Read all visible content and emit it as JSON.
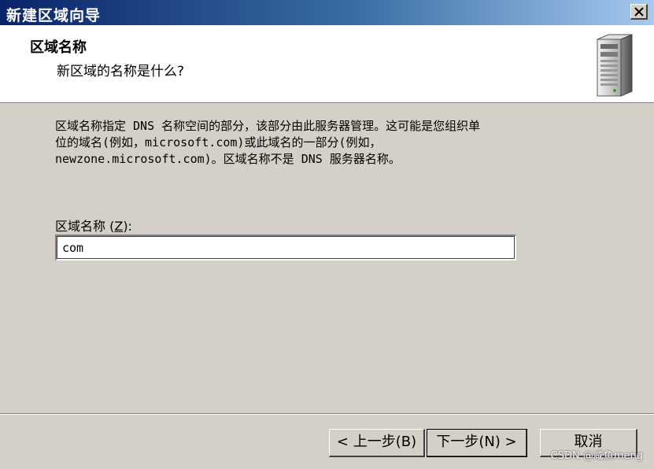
{
  "window": {
    "title": "新建区域向导",
    "close_glyph": "✕"
  },
  "header": {
    "title": "区域名称",
    "subtitle": "新区域的名称是什么?",
    "icon": "server-tower-icon"
  },
  "body": {
    "description_lines": [
      "区域名称指定 DNS 名称空间的部分，该部分由此服务器管理。这可能是您组织单",
      "位的域名(例如，microsoft.com)或此域名的一部分(例如，",
      "newzone.microsoft.com)。区域名称不是 DNS 服务器名称。"
    ],
    "zone_name_label": "区域名称 (",
    "zone_name_accel": "Z",
    "zone_name_label_end": "):",
    "zone_name_value": "com"
  },
  "footer": {
    "back_label": "< 上一步(B)",
    "next_label": "下一步(N) >",
    "cancel_label": "取消"
  },
  "watermark": "CSDN @咸鱼meng",
  "colors": {
    "face": "#d4d0c8",
    "title_start": "#0a246a",
    "title_end": "#a6caf0"
  }
}
